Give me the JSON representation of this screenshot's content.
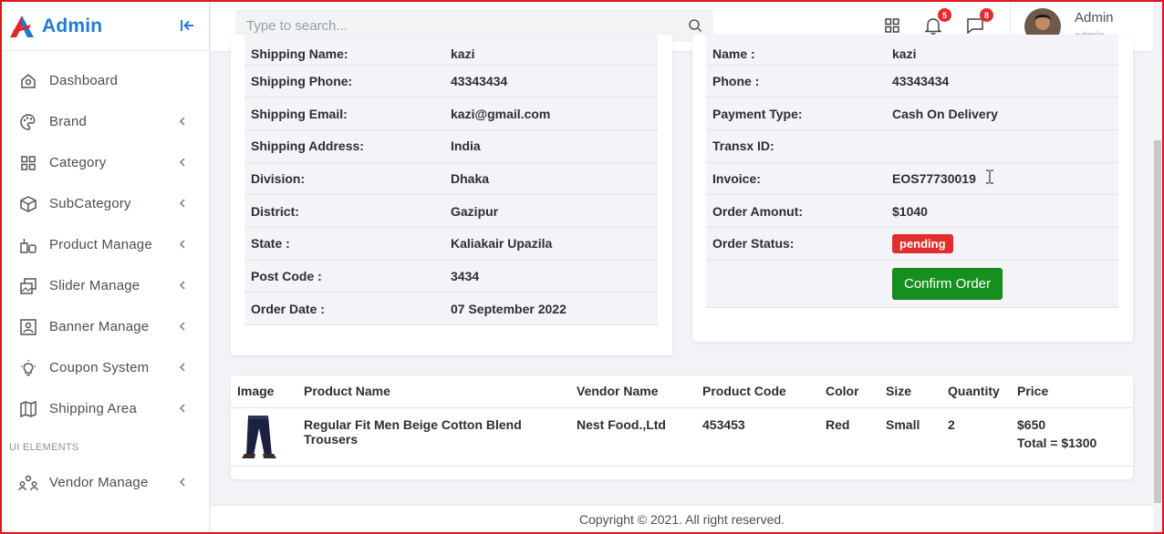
{
  "brand": {
    "name": "Admin"
  },
  "sidebar": {
    "items": [
      {
        "label": "Dashboard",
        "icon": "home-icon",
        "chevron": false
      },
      {
        "label": "Brand",
        "icon": "palette-icon",
        "chevron": true
      },
      {
        "label": "Category",
        "icon": "grid-icon",
        "chevron": true
      },
      {
        "label": "SubCategory",
        "icon": "cube-icon",
        "chevron": true
      },
      {
        "label": "Product Manage",
        "icon": "product-icon",
        "chevron": true
      },
      {
        "label": "Slider Manage",
        "icon": "images-icon",
        "chevron": true
      },
      {
        "label": "Banner Manage",
        "icon": "image-icon",
        "chevron": true
      },
      {
        "label": "Coupon System",
        "icon": "bulb-icon",
        "chevron": true
      },
      {
        "label": "Shipping Area",
        "icon": "map-icon",
        "chevron": true
      }
    ],
    "section_label": "UI ELEMENTS",
    "items2": [
      {
        "label": "Vendor Manage",
        "icon": "users-icon",
        "chevron": true
      }
    ]
  },
  "topbar": {
    "search_placeholder": "Type to search...",
    "notifications_count": "5",
    "messages_count": "8",
    "user_name": "Admin",
    "user_role": "admin"
  },
  "shipping_info": {
    "rows": [
      {
        "label": "Shipping Name:",
        "value": "kazi"
      },
      {
        "label": "Shipping Phone:",
        "value": "43343434"
      },
      {
        "label": "Shipping Email:",
        "value": "kazi@gmail.com"
      },
      {
        "label": "Shipping Address:",
        "value": "India"
      },
      {
        "label": "Division:",
        "value": "Dhaka"
      },
      {
        "label": "District:",
        "value": "Gazipur"
      },
      {
        "label": "State :",
        "value": "Kaliakair Upazila"
      },
      {
        "label": "Post Code :",
        "value": "3434"
      },
      {
        "label": "Order Date :",
        "value": "07 September 2022"
      }
    ]
  },
  "order_info": {
    "rows": [
      {
        "label": "Name :",
        "value": "kazi"
      },
      {
        "label": "Phone :",
        "value": "43343434"
      },
      {
        "label": "Payment Type:",
        "value": "Cash On Delivery"
      },
      {
        "label": "Transx ID:",
        "value": ""
      },
      {
        "label": "Invoice:",
        "value": "EOS77730019"
      },
      {
        "label": "Order Amonut:",
        "value": "$1040"
      }
    ],
    "status_label": "Order Status:",
    "status_value": "pending",
    "confirm_label": "Confirm Order",
    "invoice_color": "#e0262d",
    "pending_color": "#e52c2c",
    "confirm_color": "#15901f"
  },
  "products": {
    "headers": [
      "Image",
      "Product Name",
      "Vendor Name",
      "Product Code",
      "Color",
      "Size",
      "Quantity",
      "Price"
    ],
    "rows": [
      {
        "name": "Regular Fit Men Beige Cotton Blend Trousers",
        "vendor": "Nest Food.,Ltd",
        "code": "453453",
        "color": "Red",
        "size": "Small",
        "quantity": "2",
        "price": "$650",
        "total": "Total = $1300"
      }
    ]
  },
  "footer": {
    "text": "Copyright © 2021. All right reserved."
  },
  "colors": {
    "brand": "#1f7bd9",
    "badge": "#e52c2c"
  }
}
